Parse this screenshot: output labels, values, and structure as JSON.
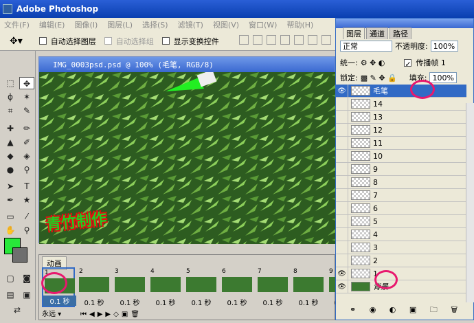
{
  "app": {
    "title": "Adobe Photoshop"
  },
  "menu": [
    "文件(F)",
    "编辑(E)",
    "图像(I)",
    "图层(L)",
    "选择(S)",
    "滤镜(T)",
    "视图(V)",
    "窗口(W)",
    "帮助(H)"
  ],
  "options": {
    "auto_select_layer": "自动选择图层",
    "auto_select_group": "自动选择组",
    "show_transform": "显示变换控件"
  },
  "document": {
    "title": "IMG_0003psd.psd @ 100% (毛笔, RGB/8)",
    "watermark": "青竹制作"
  },
  "animation": {
    "tab": "动画",
    "loop": "永远",
    "frames": [
      {
        "num": "1",
        "dur": "0.1 秒"
      },
      {
        "num": "2",
        "dur": "0.1 秒"
      },
      {
        "num": "3",
        "dur": "0.1 秒"
      },
      {
        "num": "4",
        "dur": "0.1 秒"
      },
      {
        "num": "5",
        "dur": "0.1 秒"
      },
      {
        "num": "6",
        "dur": "0.1 秒"
      },
      {
        "num": "7",
        "dur": "0.1 秒"
      },
      {
        "num": "8",
        "dur": "0.1 秒"
      },
      {
        "num": "9",
        "dur": "0.1 秒"
      }
    ]
  },
  "layers_panel": {
    "tabs": [
      "图层",
      "通道",
      "路径"
    ],
    "blend_mode": "正常",
    "opacity_label": "不透明度:",
    "opacity": "100%",
    "unify_label": "统一:",
    "propagate": "传播帧 1",
    "lock_label": "锁定:",
    "fill_label": "填充:",
    "fill": "100%",
    "layers": [
      "毛笔",
      "14",
      "13",
      "12",
      "11",
      "10",
      "9",
      "8",
      "7",
      "6",
      "5",
      "4",
      "3",
      "2",
      "1",
      "背景"
    ]
  },
  "colors": {
    "foreground": "#28e83a",
    "background": "#6e6e6e",
    "accent": "#316ac5"
  }
}
